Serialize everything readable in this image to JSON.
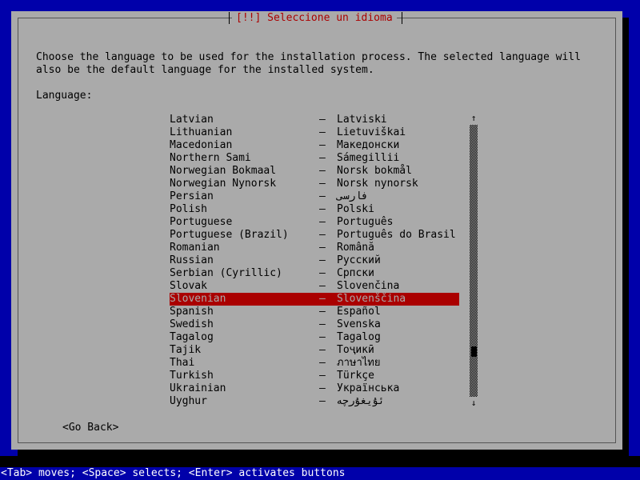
{
  "window": {
    "title": "[!!] Seleccione un idioma",
    "title_color": "#AA0000",
    "background_color": "#0000AA",
    "panel_color": "#AAAAAA"
  },
  "body": {
    "intro_line_1": "Choose the language to be used for the installation process. The selected language will",
    "intro_line_2": "also be the default language for the installed system.",
    "field_label": "Language:"
  },
  "list": {
    "separator": "–",
    "selected_index": 14,
    "items": [
      {
        "english": "Latvian",
        "native": "Latviski"
      },
      {
        "english": "Lithuanian",
        "native": "Lietuviškai"
      },
      {
        "english": "Macedonian",
        "native": "Македонски"
      },
      {
        "english": "Northern Sami",
        "native": "Sámegillii"
      },
      {
        "english": "Norwegian Bokmaal",
        "native": "Norsk bokmål"
      },
      {
        "english": "Norwegian Nynorsk",
        "native": "Norsk nynorsk"
      },
      {
        "english": "Persian",
        "native": "فارسی"
      },
      {
        "english": "Polish",
        "native": "Polski"
      },
      {
        "english": "Portuguese",
        "native": "Português"
      },
      {
        "english": "Portuguese (Brazil)",
        "native": "Português do Brasil"
      },
      {
        "english": "Romanian",
        "native": "Română"
      },
      {
        "english": "Russian",
        "native": "Русский"
      },
      {
        "english": "Serbian (Cyrillic)",
        "native": "Српски"
      },
      {
        "english": "Slovak",
        "native": "Slovenčina"
      },
      {
        "english": "Slovenian",
        "native": "Slovenščina"
      },
      {
        "english": "Spanish",
        "native": "Español"
      },
      {
        "english": "Swedish",
        "native": "Svenska"
      },
      {
        "english": "Tagalog",
        "native": "Tagalog"
      },
      {
        "english": "Tajik",
        "native": "Тоҷикӣ"
      },
      {
        "english": "Thai",
        "native": "ภาษาไทย"
      },
      {
        "english": "Turkish",
        "native": "Türkçe"
      },
      {
        "english": "Ukrainian",
        "native": "Українська"
      },
      {
        "english": "Uyghur",
        "native": "ئۇيغۇرچە"
      }
    ]
  },
  "scrollbar": {
    "arrow_up": "↑",
    "arrow_down": "↓"
  },
  "buttons": {
    "go_back": "<Go Back>"
  },
  "statusbar": {
    "hint": "<Tab> moves; <Space> selects; <Enter> activates buttons"
  }
}
